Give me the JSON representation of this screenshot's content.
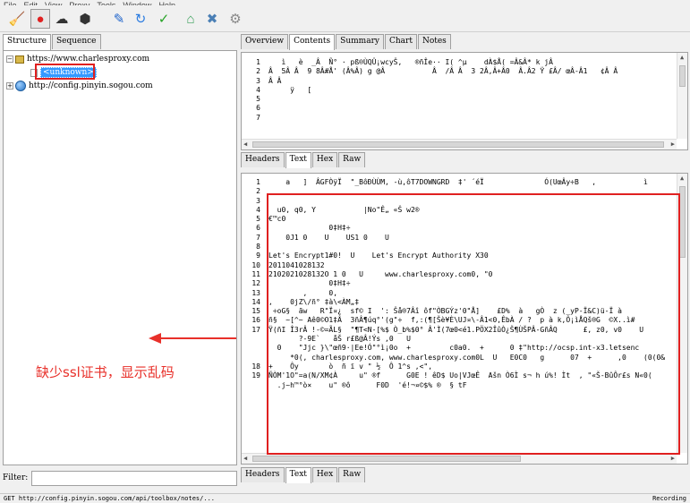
{
  "menu": [
    "File",
    "Edit",
    "View",
    "Proxy",
    "Tools",
    "Window",
    "Help"
  ],
  "toolbar": [
    {
      "name": "broom-icon",
      "glyph": "🧹",
      "color": "#c8a000"
    },
    {
      "name": "record-icon",
      "glyph": "●",
      "color": "#e02020"
    },
    {
      "name": "throttle-icon",
      "glyph": "☁",
      "color": "#333333"
    },
    {
      "name": "stop-breakpoints-icon",
      "glyph": "⬢",
      "color": "#333333"
    },
    {
      "name": "pen-icon",
      "glyph": "✎",
      "color": "#2266cc"
    },
    {
      "name": "refresh-icon",
      "glyph": "↻",
      "color": "#2a7be0"
    },
    {
      "name": "check-icon",
      "glyph": "✓",
      "color": "#27a327"
    },
    {
      "name": "basket-icon",
      "glyph": "⌂",
      "color": "#3aa05a"
    },
    {
      "name": "tools-icon",
      "glyph": "✖",
      "color": "#4a7fb5"
    },
    {
      "name": "settings-icon",
      "glyph": "⚙",
      "color": "#888888"
    }
  ],
  "left_tabs": [
    "Structure",
    "Sequence"
  ],
  "tree": {
    "host1": "https://www.charlesproxy.com",
    "child": "<unknown>",
    "host2": "http://config.pinyin.sogou.com"
  },
  "filter_label": "Filter:",
  "right_tabs": [
    "Overview",
    "Contents",
    "Summary",
    "Chart",
    "Notes"
  ],
  "sub_tabs": [
    "Headers",
    "Text",
    "Hex",
    "Raw"
  ],
  "top_pane": {
    "line_numbers": [
      "1",
      "2",
      "3",
      "4",
      "5",
      "6",
      "7"
    ],
    "lines": [
      "   ì   è  _Â  Ñ° · pß®ÙQÛ¡wcyŠ,   ®ñÎe·· I( ^µ    dÀ$Å( =Â&Â* k jÂ",
      "Â  5Â Â  9 8Â#Å' (Â%Â) g @Â           Â  /Â Â  3 2Â,Â+Â0  Â.Â2 Ÿ £Â/ œÂ-Â1   ¢Â Â",
      "Â Â",
      "     ÿ   [",
      "",
      "",
      ""
    ]
  },
  "bottom_pane": {
    "line_numbers": [
      "1",
      "2",
      "3",
      "4",
      "5",
      "6",
      "7",
      "8",
      "9",
      "10",
      "11",
      "12",
      "13",
      "14",
      "15",
      "16",
      "17",
      "",
      "",
      "",
      "18",
      "19",
      "",
      ""
    ],
    "lines": [
      "    a   ]  ÂGFÒÿÏ  \"_BôÐÙÙM, -ù,ôT7DOWNGRD  ‡' ´éÏ              Ó(UœÂy÷B   ,           ì  ",
      "",
      "",
      "  u0, q0, Y           |No\"Ê„ «Š w2®",
      "€™c0",
      "              0‡H‡÷",
      "    0J1 0    U    US1 0    U",
      "",
      "Let's Encrypt1#0!  U    Let's Encrypt Authority X30",
      "2011041028132",
      "2102021028132O 1 0   U     www.charlesproxy.com0, \"0",
      "              0‡H‡÷",
      "        ,     0,",
      ",    0jZ\\/ñ° ‡à\\<ÀM„‡",
      " ÷oG§  ãw   R\"Ï¤¿  sf© I  ': Šå®7Âî ôf\"ÒBGÝz'0\"Å]    £D%  à   gÒ  z (_yP-Ï&C)ü-Ï à",
      "ñ§  ~[^~ Aê0©O1‡Â  3ñÂ¶úq°'(g\"÷  f,:(¶[Šè¥È\\UJ¤\\-Â1<0,ÊbÀ / ?  p à k,Ô¡ìÅQš®G  ©X..ì#",
      "Ÿ(ñI Î3rÂ !-©=ÃL§  \"¶T<N-[%$ Ò_b%$0° Â'Ì(7œ0<é1.PÖX2ÎûÒ¿Š¶ÙŠPÂ-GñÂQ      £, z0, v0    U",
      "       ?-9E`   åŠ r£ß@Â!Ýs ,0   U",
      "  0    \"Jjc }\\\"œñ9·|Ee!Ó\"°ì¡0o  +         c0a0.  +      0 ‡\"http://ocsp.int-x3.letsenc",
      "     *0(, charlesproxy.com, www.charlesproxy.com0L  U   E0C0   g      07  +      ,0    (0(0&",
      "+    Ôy       ò  ñ ï v \" ½  Ô 1^s ,<\",",
      "ÑÒM'1O\"=a(N/XM¢À     u\" ®f      G0E ! êD$ Uo|VJœÊ  Ašn Ò6Ì s¬ h ú%! Ìt  , \"«Š-BûÔr£s N«0(",
      "  .j~h™°ò×    u\" ®ô      F0D  'é!¬¤©$% ®  § tF",
      ""
    ]
  },
  "annotation": "缺少ssl证书，显示乱码",
  "status": {
    "left": "GET http://config.pinyin.sogou.com/api/toolbox/notes/...",
    "right": "Recording"
  },
  "colors": {
    "accent_red": "#e02020",
    "selection_blue": "#3399ff"
  }
}
